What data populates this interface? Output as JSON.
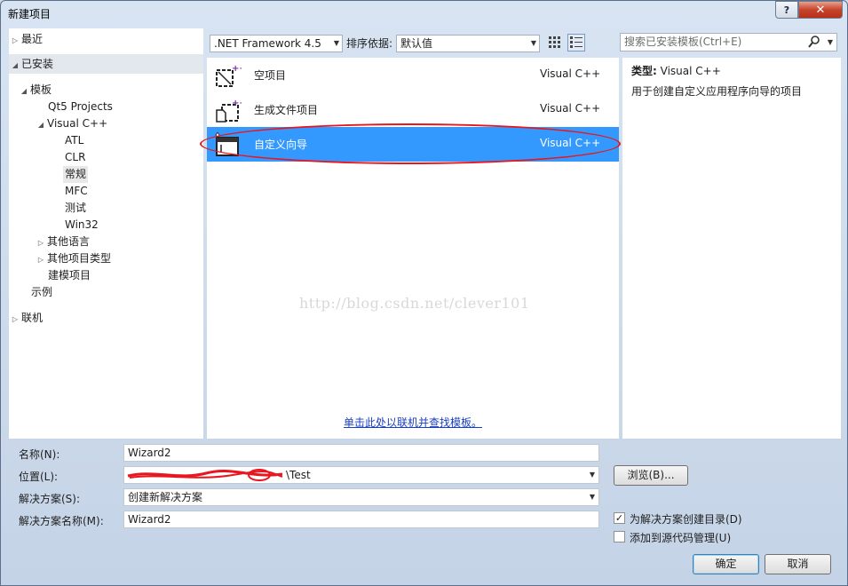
{
  "window": {
    "title": "新建项目",
    "help": "?",
    "close": "✕"
  },
  "tree": {
    "recent": "最近",
    "installed": "已安装",
    "templates": "模板",
    "qt5": "Qt5 Projects",
    "vcpp": "Visual C++",
    "atl": "ATL",
    "clr": "CLR",
    "general": "常规",
    "mfc": "MFC",
    "test": "测试",
    "win32": "Win32",
    "other_langs": "其他语言",
    "other_types": "其他项目类型",
    "modeling": "建模项目",
    "samples": "示例",
    "online": "联机"
  },
  "toolbar": {
    "framework": ".NET Framework 4.5",
    "sort_label": "排序依据:",
    "sort_value": "默认值",
    "search_placeholder": "搜索已安装模板(Ctrl+E)"
  },
  "templates": [
    {
      "name": "空项目",
      "lang": "Visual C++",
      "selected": false
    },
    {
      "name": "生成文件项目",
      "lang": "Visual C++",
      "selected": false
    },
    {
      "name": "自定义向导",
      "lang": "Visual C++",
      "selected": true
    }
  ],
  "online_link": "单击此处以联机并查找模板。",
  "watermark": "http://blog.csdn.net/clever101",
  "details": {
    "type_label": "类型:",
    "type_value": "Visual C++",
    "description": "用于创建自定义应用程序向导的项目"
  },
  "form": {
    "name_label": "名称(N):",
    "name_value": "Wizard2",
    "location_label": "位置(L):",
    "location_value": "\\Test",
    "solution_label": "解决方案(S):",
    "solution_value": "创建新解决方案",
    "solution_name_label": "解决方案名称(M):",
    "solution_name_value": "Wizard2",
    "browse": "浏览(B)...",
    "create_dir": "为解决方案创建目录(D)",
    "source_control": "添加到源代码管理(U)",
    "ok": "确定",
    "cancel": "取消"
  },
  "colors": {
    "selection": "#3399ff",
    "annotation": "#e8161e",
    "link": "#1a3fbd"
  }
}
